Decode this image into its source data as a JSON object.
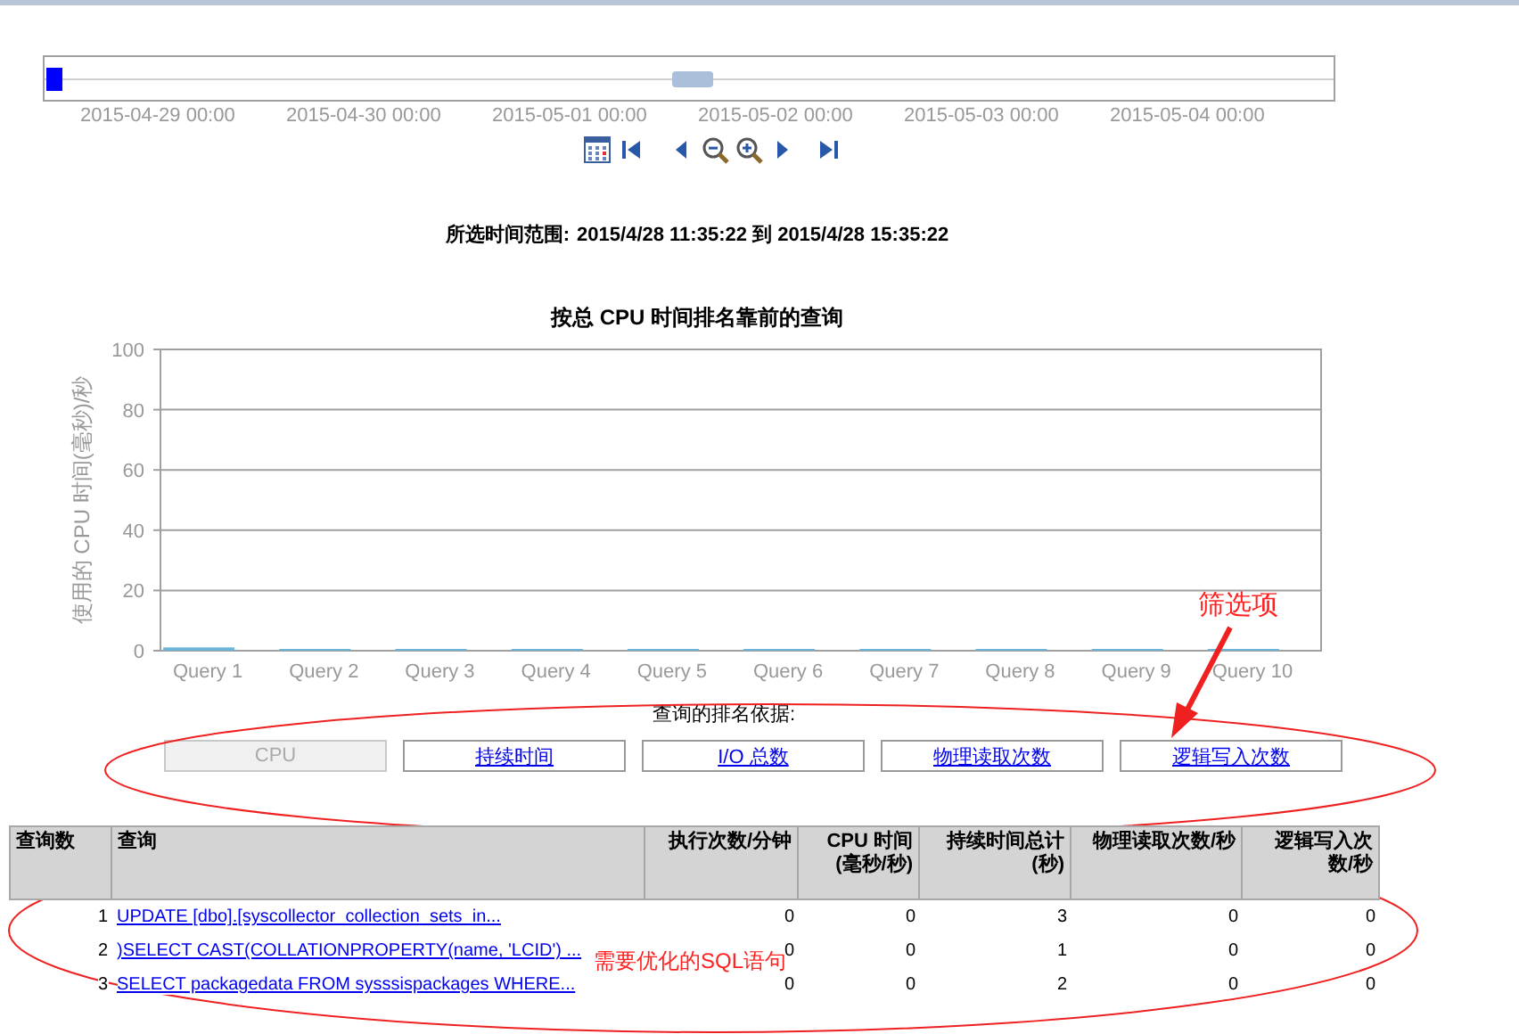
{
  "timeline": {
    "dates": [
      "2015-04-29 00:00",
      "2015-04-30 00:00",
      "2015-05-01 00:00",
      "2015-05-02 00:00",
      "2015-05-03 00:00",
      "2015-05-04 00:00"
    ]
  },
  "selected_range": {
    "label": "所选时间范围:",
    "value": "2015/4/28 11:35:22 到 2015/4/28 15:35:22"
  },
  "chart": {
    "chart_data": {
      "type": "bar",
      "title": "按总 CPU 时间排名靠前的查询",
      "ylabel": "使用的 CPU 时间(毫秒)/秒",
      "categories": [
        "Query 1",
        "Query 2",
        "Query 3",
        "Query 4",
        "Query 5",
        "Query 6",
        "Query 7",
        "Query 8",
        "Query 9",
        "Query 10"
      ],
      "values": [
        0.5,
        0,
        0,
        0,
        0,
        0,
        0,
        0,
        0,
        0
      ],
      "ylim": [
        0,
        100
      ],
      "grid": true,
      "yticks": [
        0,
        20,
        40,
        60,
        80,
        100
      ]
    }
  },
  "ranking": {
    "label": "查询的排名依据:",
    "options": [
      {
        "label": "CPU",
        "selected": true
      },
      {
        "label": "持续时间",
        "selected": false
      },
      {
        "label": "I/O 总数",
        "selected": false
      },
      {
        "label": "物理读取次数",
        "selected": false
      },
      {
        "label": "逻辑写入次数",
        "selected": false
      }
    ]
  },
  "table": {
    "columns": [
      "查询数",
      "查询",
      "执行次数/分钟",
      "CPU 时间\n(毫秒/秒)",
      "持续时间总计\n(秒)",
      "物理读取次数/秒",
      "逻辑写入次数/秒"
    ],
    "rows": [
      [
        "1",
        "UPDATE [dbo].[syscollector_collection_sets_in...",
        "0",
        "0",
        "3",
        "0",
        "0"
      ],
      [
        "2",
        ")SELECT CAST(COLLATIONPROPERTY(name, 'LCID') ...",
        "0",
        "0",
        "1",
        "0",
        "0"
      ],
      [
        "3",
        "SELECT packagedata FROM sysssispackages WHERE...",
        "0",
        "0",
        "2",
        "0",
        "0"
      ]
    ]
  },
  "annotations": [
    {
      "kind": "label",
      "text": "筛选项"
    },
    {
      "kind": "label",
      "text": "需要优化的SQL语句"
    }
  ]
}
